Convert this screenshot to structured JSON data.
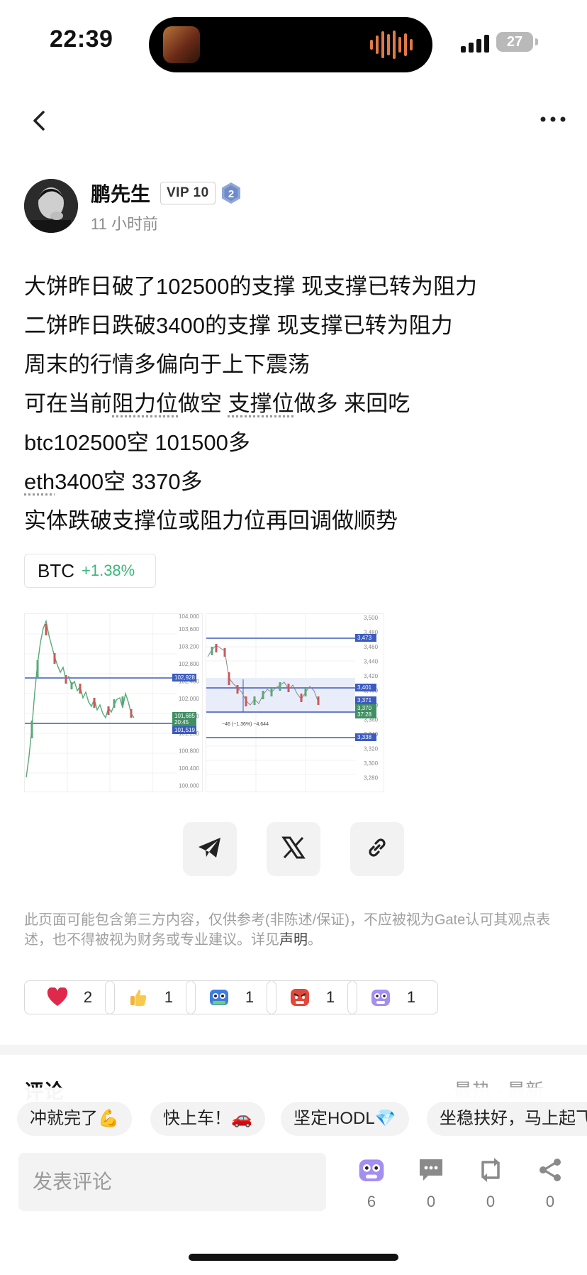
{
  "status_bar": {
    "time": "22:39",
    "battery": "27"
  },
  "author": {
    "name": "鹏先生",
    "vip": "VIP 10",
    "level": "2",
    "time": "11 小时前"
  },
  "post": {
    "lines": [
      "大饼昨日破了102500的支撑 现支撑已转为阻力",
      "二饼昨日跌破3400的支撑 现支撑已转为阻力",
      "周末的行情多偏向于上下震荡"
    ],
    "line4": {
      "a": "可在当前",
      "b": "阻力位",
      "c": "做空 ",
      "d": "支撑位",
      "e": "做多 来回吃"
    },
    "line5": "btc102500空 101500多",
    "line6": {
      "a": "eth",
      "b": "3400空 3370多"
    },
    "line7": "实体跌破支撑位或阻力位再回调做顺势"
  },
  "ticker": {
    "symbol": "BTC",
    "change": "+1.38%",
    "up_color": "#3bb57a"
  },
  "charts": {
    "btc": {
      "price_ticks": [
        "103,600",
        "103,200",
        "102,800",
        "102,400",
        "102,000",
        "101,600",
        "101,200",
        "100,800",
        "100,400",
        "100,000"
      ],
      "top_label": "104,000",
      "tag_resist": "102,928",
      "tag_price": "101,685",
      "tag_time": "20:45",
      "tag_support": "101,519"
    },
    "eth": {
      "price_ticks": [
        "3,500",
        "3,480",
        "3,460",
        "3,440",
        "3,420",
        "3,400",
        "3,380",
        "3,360",
        "3,340",
        "3,320",
        "3,300",
        "3,280"
      ],
      "tag_top": "3,473",
      "tag_mid": "3,401",
      "tag_371": "3,371",
      "tag_370": "3,370",
      "tag_time": "37:28",
      "tag_low": "3,338",
      "measure": "−46 (−1.36%) −4,644"
    }
  },
  "share": {
    "items": [
      "telegram-icon",
      "x-icon",
      "link-icon"
    ]
  },
  "disclaimer": {
    "text": "此页面可能包含第三方内容，仅供参考(非陈述/保证)，不应被视为Gate认可其观点表述，也不得被视为财务或专业建议。详见",
    "link": "声明",
    "end": "。"
  },
  "reactions": [
    {
      "icon": "heart-icon",
      "count": "2"
    },
    {
      "icon": "thumbs-up-icon",
      "count": "1"
    },
    {
      "icon": "hodl-robot-icon",
      "count": "1"
    },
    {
      "icon": "angry-face-icon",
      "count": "1"
    },
    {
      "icon": "purple-monster-icon",
      "count": "1"
    }
  ],
  "comments_peek": {
    "title": "评论",
    "sort": "最热 · 最新"
  },
  "quick_replies": [
    "冲就完了💪",
    "快上车！🚗",
    "坚定HODL💎",
    "坐稳扶好，马上起飞"
  ],
  "comment_input": {
    "placeholder": "发表评论"
  },
  "actions": [
    {
      "icon": "purple-monster-icon",
      "count": "6"
    },
    {
      "icon": "comment-icon",
      "count": "0"
    },
    {
      "icon": "repost-icon",
      "count": "0"
    },
    {
      "icon": "share-icon",
      "count": "0"
    }
  ]
}
